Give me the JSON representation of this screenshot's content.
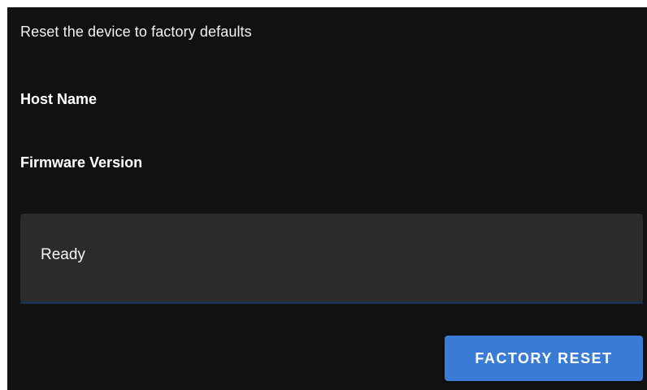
{
  "description": "Reset the device to factory defaults",
  "fields": {
    "host_name_label": "Host Name",
    "firmware_version_label": "Firmware Version"
  },
  "status": {
    "text": "Ready"
  },
  "actions": {
    "factory_reset_label": "FACTORY RESET"
  },
  "colors": {
    "background": "#111111",
    "status_box": "#2b2b2b",
    "button": "#3a7bd5"
  }
}
